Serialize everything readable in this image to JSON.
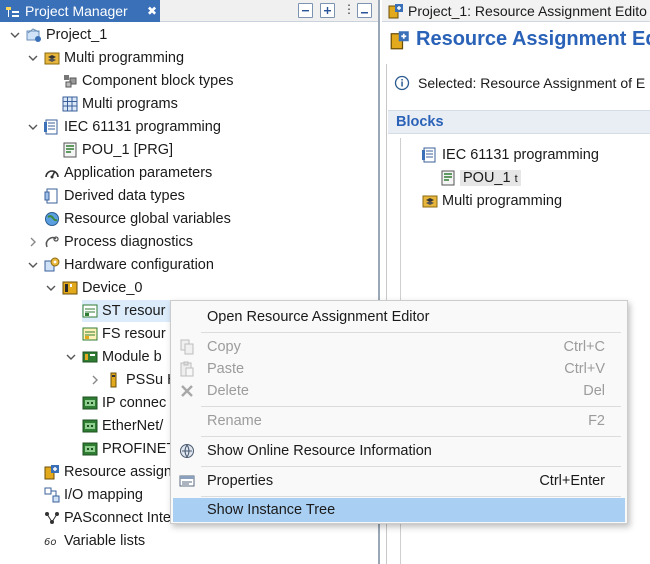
{
  "project_manager": {
    "tab_title": "Project Manager",
    "close_glyph": "✖",
    "tree": {
      "project": "Project_1",
      "multi_programming": "Multi programming",
      "component_block_types": "Component block types",
      "multi_programs": "Multi programs",
      "iec_programming": "IEC 61131 programming",
      "pou": "POU_1 [PRG]",
      "application_parameters": "Application parameters",
      "derived_data_types": "Derived data types",
      "resource_global_variables": "Resource global variables",
      "process_diagnostics": "Process diagnostics",
      "hardware_configuration": "Hardware configuration",
      "device": "Device_0",
      "st_resource": "ST resour",
      "fs_resource": "FS resour",
      "module_bus": "Module b",
      "pssu": "PSSu H",
      "ip_connect": "IP connec",
      "ethernet": "EtherNet/",
      "profinet": "PROFINET",
      "resource_assignment": "Resource assign",
      "io_mapping": "I/O mapping",
      "pasconnect": "PASconnect Inte",
      "variable_lists": "Variable lists"
    }
  },
  "editor": {
    "tab_title": "Project_1: Resource Assignment Edito",
    "heading": "Resource Assignment Ed",
    "selected_text": "Selected: Resource Assignment of E",
    "blocks_label": "Blocks",
    "blocks_tree": {
      "iec_programming": "IEC 61131 programming",
      "pou": "POU_1",
      "pou_suffix": "t",
      "multi_programming": "Multi programming"
    }
  },
  "context_menu": {
    "items": [
      {
        "label": "Open Resource Assignment Editor",
        "shortcut": ""
      },
      {
        "label": "Copy",
        "shortcut": "Ctrl+C"
      },
      {
        "label": "Paste",
        "shortcut": "Ctrl+V"
      },
      {
        "label": "Delete",
        "shortcut": "Del"
      },
      {
        "label": "Rename",
        "shortcut": "F2"
      },
      {
        "label": "Show Online Resource Information",
        "shortcut": ""
      },
      {
        "label": "Properties",
        "shortcut": "Ctrl+Enter"
      },
      {
        "label": "Show Instance Tree",
        "shortcut": ""
      }
    ]
  },
  "colors": {
    "accent_blue": "#2a62b8",
    "tab_active": "#3a70b8",
    "menu_highlight": "#a9cff2"
  }
}
